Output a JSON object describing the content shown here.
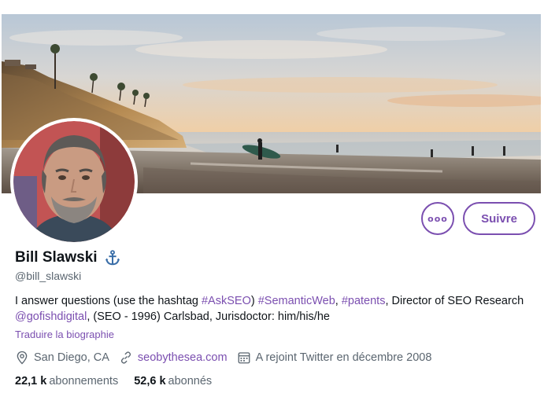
{
  "profile": {
    "display_name": "Bill Slawski",
    "handle": "@bill_slawski",
    "bio_parts": {
      "p1": "I answer questions (use the hashtag ",
      "tag1": "#AskSEO",
      "p2": ") ",
      "tag2": "#SemanticWeb",
      "p3": ", ",
      "tag3": "#patents",
      "p4": ", Director of SEO Research ",
      "mention": "@gofishdigital",
      "p5": ",  (SEO - 1996) Carlsbad, Jurisdoctor: him/his/he"
    },
    "translate_label": "Traduire la biographie",
    "location": "San Diego, CA",
    "website": "seobythesea.com",
    "joined": "A rejoint Twitter en décembre 2008",
    "following_count": "22,1 k",
    "following_label": "abonnements",
    "followers_count": "52,6 k",
    "followers_label": "abonnés"
  },
  "actions": {
    "more_label": "ooo",
    "follow_label": "Suivre"
  },
  "colors": {
    "accent": "#7b4fb0",
    "secondary_text": "#5b6670"
  },
  "icons": {
    "badge": "anchor-icon",
    "location": "location-pin-icon",
    "website": "link-icon",
    "joined": "calendar-icon"
  }
}
